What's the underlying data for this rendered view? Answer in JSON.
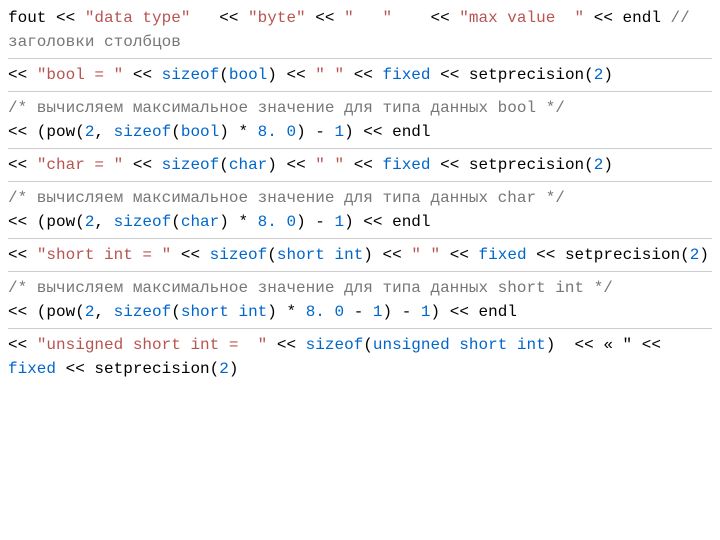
{
  "tokens": [
    {
      "cls": "",
      "t": "fout << "
    },
    {
      "cls": "str",
      "t": "\"data type\""
    },
    {
      "cls": "",
      "t": "   << "
    },
    {
      "cls": "str",
      "t": "\"byte\""
    },
    {
      "cls": "",
      "t": " << "
    },
    {
      "cls": "str",
      "t": "\"   \""
    },
    {
      "cls": "",
      "t": "    << "
    },
    {
      "cls": "str",
      "t": "\"max value  \""
    },
    {
      "cls": "",
      "t": " << endl "
    },
    {
      "cls": "cm",
      "t": "// заголовки столбцов"
    },
    {
      "cls": "",
      "t": "\n"
    },
    {
      "cls": "break",
      "t": ""
    },
    {
      "cls": "",
      "t": "<< "
    },
    {
      "cls": "str",
      "t": "\"bool = \""
    },
    {
      "cls": "",
      "t": " << "
    },
    {
      "cls": "kw",
      "t": "sizeof"
    },
    {
      "cls": "",
      "t": "("
    },
    {
      "cls": "kw",
      "t": "bool"
    },
    {
      "cls": "",
      "t": ") << "
    },
    {
      "cls": "str",
      "t": "\" \""
    },
    {
      "cls": "",
      "t": " << "
    },
    {
      "cls": "kw",
      "t": "fixed"
    },
    {
      "cls": "",
      "t": " << setprecision("
    },
    {
      "cls": "kw",
      "t": "2"
    },
    {
      "cls": "",
      "t": ")"
    },
    {
      "cls": "",
      "t": "\n"
    },
    {
      "cls": "break",
      "t": ""
    },
    {
      "cls": "cm",
      "t": "/* вычисляем максимальное значение для типа данных bool */"
    },
    {
      "cls": "",
      "t": "\n<< (pow("
    },
    {
      "cls": "kw",
      "t": "2"
    },
    {
      "cls": "",
      "t": ", "
    },
    {
      "cls": "kw",
      "t": "sizeof"
    },
    {
      "cls": "",
      "t": "("
    },
    {
      "cls": "kw",
      "t": "bool"
    },
    {
      "cls": "",
      "t": ") * "
    },
    {
      "cls": "kw",
      "t": "8. 0"
    },
    {
      "cls": "",
      "t": ") - "
    },
    {
      "cls": "kw",
      "t": "1"
    },
    {
      "cls": "",
      "t": ") << endl"
    },
    {
      "cls": "",
      "t": "\n"
    },
    {
      "cls": "break",
      "t": ""
    },
    {
      "cls": "",
      "t": "<< "
    },
    {
      "cls": "str",
      "t": "\"char = \""
    },
    {
      "cls": "",
      "t": " << "
    },
    {
      "cls": "kw",
      "t": "sizeof"
    },
    {
      "cls": "",
      "t": "("
    },
    {
      "cls": "kw",
      "t": "char"
    },
    {
      "cls": "",
      "t": ") << "
    },
    {
      "cls": "str",
      "t": "\" \""
    },
    {
      "cls": "",
      "t": " << "
    },
    {
      "cls": "kw",
      "t": "fixed"
    },
    {
      "cls": "",
      "t": " << setprecision("
    },
    {
      "cls": "kw",
      "t": "2"
    },
    {
      "cls": "",
      "t": ")"
    },
    {
      "cls": "",
      "t": "\n"
    },
    {
      "cls": "break",
      "t": ""
    },
    {
      "cls": "cm",
      "t": "/* вычисляем максимальное значение для типа данных char */"
    },
    {
      "cls": "",
      "t": "\n<< (pow("
    },
    {
      "cls": "kw",
      "t": "2"
    },
    {
      "cls": "",
      "t": ", "
    },
    {
      "cls": "kw",
      "t": "sizeof"
    },
    {
      "cls": "",
      "t": "("
    },
    {
      "cls": "kw",
      "t": "char"
    },
    {
      "cls": "",
      "t": ") * "
    },
    {
      "cls": "kw",
      "t": "8. 0"
    },
    {
      "cls": "",
      "t": ") - "
    },
    {
      "cls": "kw",
      "t": "1"
    },
    {
      "cls": "",
      "t": ") << endl"
    },
    {
      "cls": "",
      "t": "\n"
    },
    {
      "cls": "break",
      "t": ""
    },
    {
      "cls": "",
      "t": "<< "
    },
    {
      "cls": "str",
      "t": "\"short int = \""
    },
    {
      "cls": "",
      "t": " << "
    },
    {
      "cls": "kw",
      "t": "sizeof"
    },
    {
      "cls": "",
      "t": "("
    },
    {
      "cls": "kw",
      "t": "short"
    },
    {
      "cls": "",
      "t": " "
    },
    {
      "cls": "kw",
      "t": "int"
    },
    {
      "cls": "",
      "t": ") << "
    },
    {
      "cls": "str",
      "t": "\" \""
    },
    {
      "cls": "",
      "t": " << "
    },
    {
      "cls": "kw",
      "t": "fixed"
    },
    {
      "cls": "",
      "t": " << setprecision("
    },
    {
      "cls": "kw",
      "t": "2"
    },
    {
      "cls": "",
      "t": ")"
    },
    {
      "cls": "",
      "t": "\n"
    },
    {
      "cls": "break",
      "t": ""
    },
    {
      "cls": "cm",
      "t": "/* вычисляем максимальное значение для типа данных short int */"
    },
    {
      "cls": "",
      "t": "\n<< (pow("
    },
    {
      "cls": "kw",
      "t": "2"
    },
    {
      "cls": "",
      "t": ", "
    },
    {
      "cls": "kw",
      "t": "sizeof"
    },
    {
      "cls": "",
      "t": "("
    },
    {
      "cls": "kw",
      "t": "short"
    },
    {
      "cls": "",
      "t": " "
    },
    {
      "cls": "kw",
      "t": "int"
    },
    {
      "cls": "",
      "t": ") * "
    },
    {
      "cls": "kw",
      "t": "8. 0"
    },
    {
      "cls": "",
      "t": " - "
    },
    {
      "cls": "kw",
      "t": "1"
    },
    {
      "cls": "",
      "t": ") - "
    },
    {
      "cls": "kw",
      "t": "1"
    },
    {
      "cls": "",
      "t": ") << endl"
    },
    {
      "cls": "",
      "t": "\n"
    },
    {
      "cls": "break",
      "t": ""
    },
    {
      "cls": "",
      "t": "<< "
    },
    {
      "cls": "str",
      "t": "\"unsigned short int =  \""
    },
    {
      "cls": "",
      "t": " << "
    },
    {
      "cls": "kw",
      "t": "sizeof"
    },
    {
      "cls": "",
      "t": "("
    },
    {
      "cls": "kw",
      "t": "unsigned"
    },
    {
      "cls": "",
      "t": " "
    },
    {
      "cls": "kw",
      "t": "short"
    },
    {
      "cls": "",
      "t": " "
    },
    {
      "cls": "kw",
      "t": "int"
    },
    {
      "cls": "",
      "t": ")  << « \" << "
    },
    {
      "cls": "kw",
      "t": "fixed"
    },
    {
      "cls": "",
      "t": " << setprecision("
    },
    {
      "cls": "kw",
      "t": "2"
    },
    {
      "cls": "",
      "t": ")"
    },
    {
      "cls": "",
      "t": "\n"
    }
  ]
}
